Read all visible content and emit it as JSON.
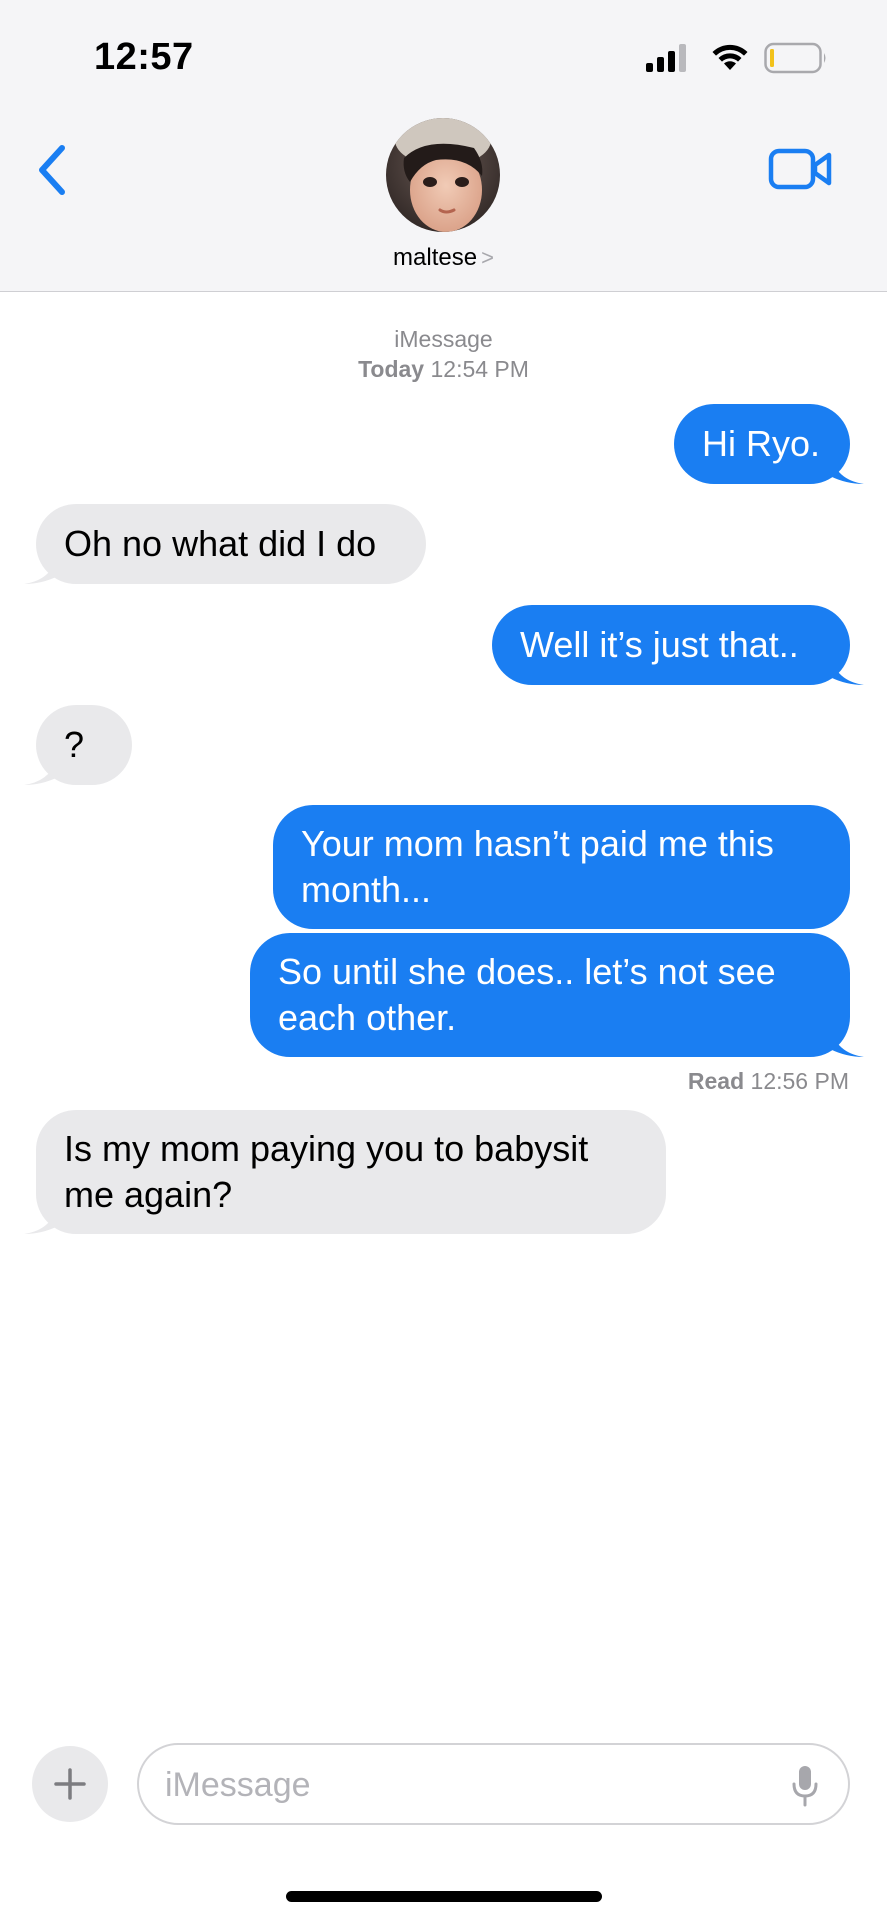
{
  "status_bar": {
    "time": "12:57"
  },
  "header": {
    "contact_name": "maltese",
    "name_chevron": ">",
    "icons": {
      "back": "chevron-left-icon",
      "video": "video-camera-icon"
    },
    "accent_color": "#1a7ef2"
  },
  "thread": {
    "service": "iMessage",
    "date_label": "Today",
    "date_time": "12:54 PM",
    "messages": [
      {
        "direction": "outgoing",
        "text": "Hi Ryo."
      },
      {
        "direction": "incoming",
        "text": "Oh no what did I do"
      },
      {
        "direction": "outgoing",
        "text": "Well it’s just that.."
      },
      {
        "direction": "incoming",
        "text": "?"
      },
      {
        "direction": "outgoing",
        "text": "Your mom hasn’t paid me this month..."
      },
      {
        "direction": "outgoing",
        "text": "So until she does.. let’s not see each other."
      },
      {
        "direction": "incoming",
        "text": "Is my mom paying you to babysit me again?"
      }
    ],
    "read_receipt": {
      "label": "Read",
      "time": "12:56 PM"
    }
  },
  "composer": {
    "placeholder": "iMessage",
    "value": "",
    "icons": {
      "add": "plus-icon",
      "dictation": "microphone-icon"
    }
  },
  "colors": {
    "outgoing_bubble": "#1a7ef2",
    "incoming_bubble": "#e9e9eb",
    "header_background": "#f5f5f7"
  }
}
